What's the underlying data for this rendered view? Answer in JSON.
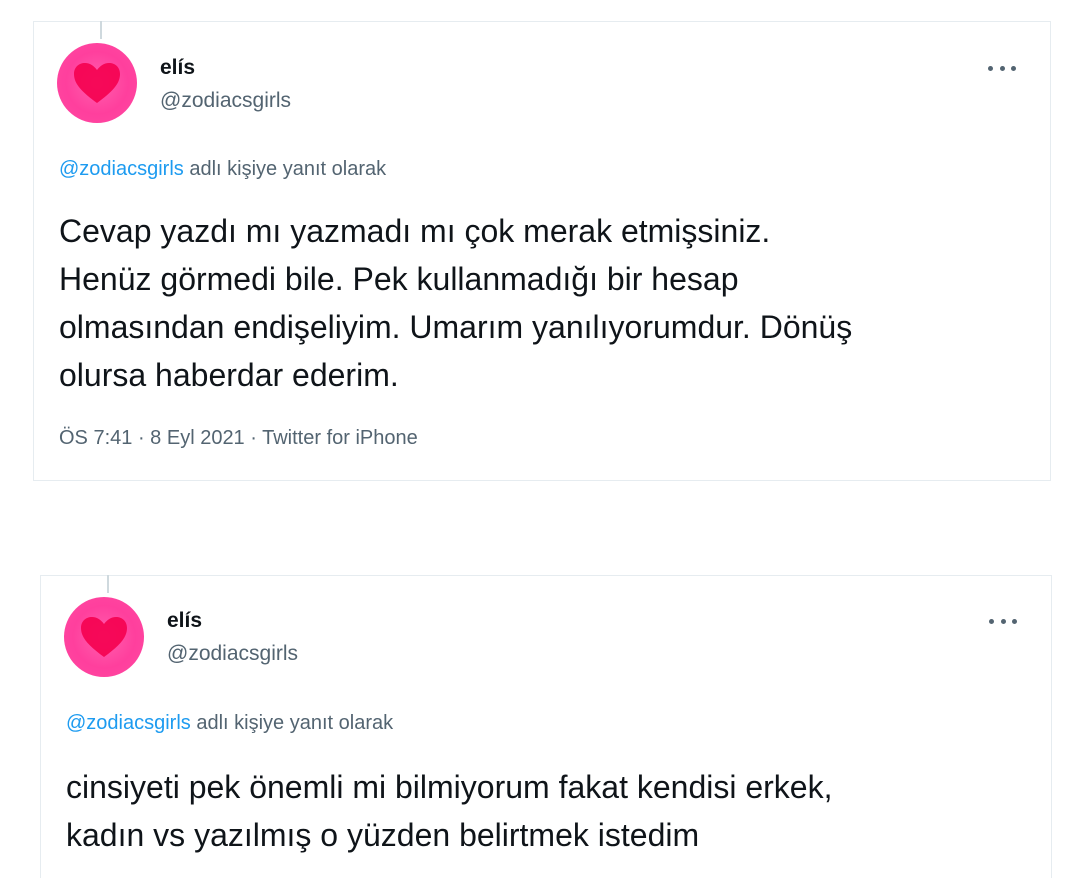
{
  "tweets": [
    {
      "display_name": "elís",
      "handle": "@zodiacsgirls",
      "reply_mention": "@zodiacsgirls",
      "reply_suffix": " adlı kişiye yanıt olarak",
      "text_lines": [
        "Cevap yazdı mı yazmadı mı çok merak etmişsiniz.",
        "Henüz görmedi bile. Pek kullanmadığı bir hesap",
        "olmasından endişeliyim. Umarım yanılıyorumdur. Dönüş",
        "olursa haberdar ederim."
      ],
      "time": "ÖS 7:41",
      "date": "8 Eyl 2021",
      "source": "Twitter for iPhone",
      "separator": " · "
    },
    {
      "display_name": "elís",
      "handle": "@zodiacsgirls",
      "reply_mention": "@zodiacsgirls",
      "reply_suffix": " adlı kişiye yanıt olarak",
      "text_lines": [
        "cinsiyeti pek önemli mi bilmiyorum fakat kendisi erkek,",
        "kadın vs yazılmış o yüzden belirtmek istedim"
      ]
    }
  ],
  "icons": {
    "avatar": "heart-avatar-icon",
    "more": "more-options-icon"
  },
  "colors": {
    "mention": "#1d9bf0",
    "secondary_text": "#536471",
    "avatar_pink": "#ff3f9d",
    "heart_red": "#f5004f"
  }
}
